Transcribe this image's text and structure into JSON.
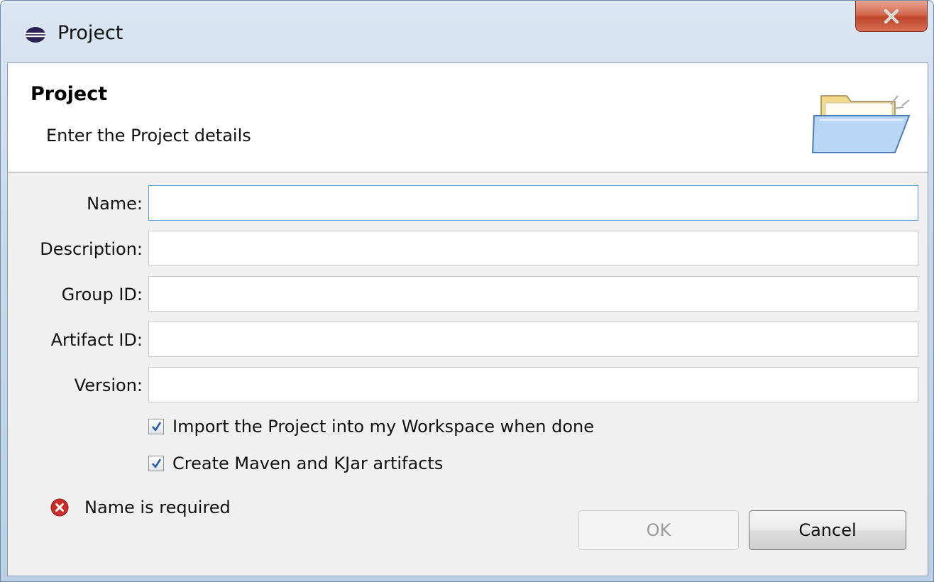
{
  "window": {
    "title": "Project",
    "close_label": "X"
  },
  "banner": {
    "title": "Project",
    "subtitle": "Enter the Project details"
  },
  "form": {
    "fields": [
      {
        "label": "Name:",
        "value": ""
      },
      {
        "label": "Description:",
        "value": ""
      },
      {
        "label": "Group ID:",
        "value": ""
      },
      {
        "label": "Artifact ID:",
        "value": ""
      },
      {
        "label": "Version:",
        "value": ""
      }
    ],
    "checkboxes": [
      {
        "label": "Import the Project into my Workspace when done",
        "checked": true
      },
      {
        "label": "Create Maven and KJar artifacts",
        "checked": true
      }
    ]
  },
  "status": {
    "error_message": "Name is required"
  },
  "buttons": {
    "ok_label": "OK",
    "ok_enabled": false,
    "cancel_label": "Cancel"
  },
  "colors": {
    "error": "#c9302c",
    "focus_border": "#5f9ad6",
    "check": "#2a5fb0"
  },
  "icons": {
    "title": "eclipse-icon",
    "banner": "open-folder-icon",
    "error": "error-icon",
    "close": "close-icon",
    "checkmark": "checkmark-icon"
  }
}
